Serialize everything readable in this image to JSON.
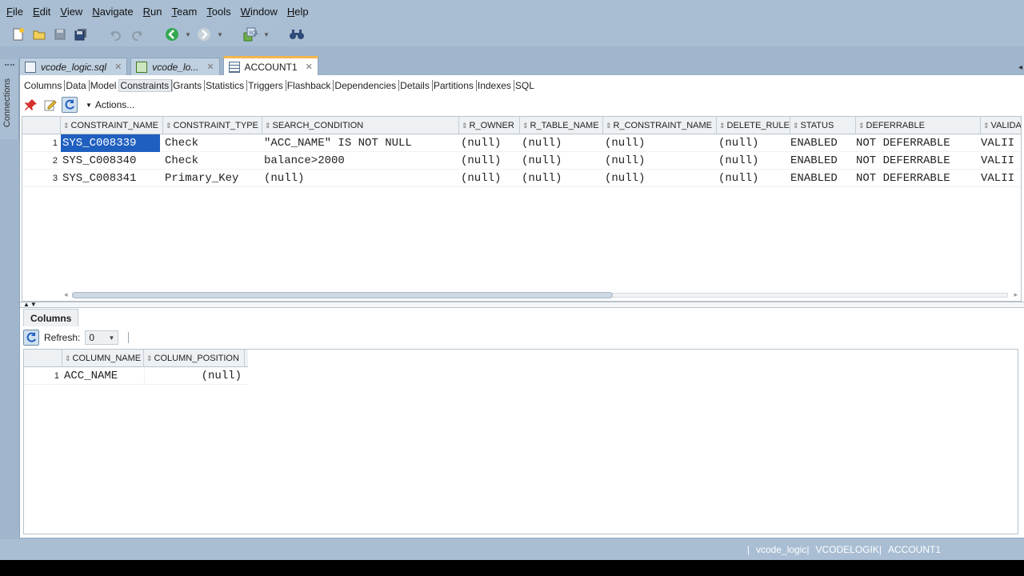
{
  "menu": {
    "items": [
      {
        "label": "File",
        "mnemonic": "F",
        "rest": "ile"
      },
      {
        "label": "Edit",
        "mnemonic": "E",
        "rest": "dit"
      },
      {
        "label": "View",
        "mnemonic": "V",
        "rest": "iew"
      },
      {
        "label": "Navigate",
        "mnemonic": "N",
        "rest": "avigate"
      },
      {
        "label": "Run",
        "mnemonic": "R",
        "rest": "un"
      },
      {
        "label": "Team",
        "mnemonic": "T",
        "rest": "eam"
      },
      {
        "label": "Tools",
        "mnemonic": "T",
        "rest": "ools"
      },
      {
        "label": "Window",
        "mnemonic": "W",
        "rest": "indow"
      },
      {
        "label": "Help",
        "mnemonic": "H",
        "rest": "elp"
      }
    ]
  },
  "toolbar": {
    "icons": [
      "new-file-icon",
      "open-folder-icon",
      "save-icon",
      "save-all-icon",
      "undo-icon",
      "redo-icon",
      "back-icon",
      "forward-icon",
      "sql-worksheet-icon",
      "binoculars-icon"
    ]
  },
  "rail": {
    "label": "Connections"
  },
  "editor_tabs": [
    {
      "label": "vcode_logic.sql",
      "active": false
    },
    {
      "label": "vcode_lo...",
      "active": false
    },
    {
      "label": "ACCOUNT1",
      "active": true
    }
  ],
  "subtabs": [
    "Columns",
    "Data",
    "Model",
    "Constraints",
    "Grants",
    "Statistics",
    "Triggers",
    "Flashback",
    "Dependencies",
    "Details",
    "Partitions",
    "Indexes",
    "SQL"
  ],
  "selected_subtab": "Constraints",
  "actions": {
    "label": "Actions..."
  },
  "constraints": {
    "columns": [
      "CONSTRAINT_NAME",
      "CONSTRAINT_TYPE",
      "SEARCH_CONDITION",
      "R_OWNER",
      "R_TABLE_NAME",
      "R_CONSTRAINT_NAME",
      "DELETE_RULE",
      "STATUS",
      "DEFERRABLE",
      "VALIDA"
    ],
    "rows": [
      {
        "num": "1",
        "cells": [
          "SYS_C008339",
          "Check",
          "\"ACC_NAME\" IS NOT NULL",
          "(null)",
          "(null)",
          "(null)",
          "(null)",
          "ENABLED",
          "NOT DEFERRABLE",
          "VALII"
        ]
      },
      {
        "num": "2",
        "cells": [
          "SYS_C008340",
          "Check",
          "balance>2000",
          "(null)",
          "(null)",
          "(null)",
          "(null)",
          "ENABLED",
          "NOT DEFERRABLE",
          "VALII"
        ]
      },
      {
        "num": "3",
        "cells": [
          "SYS_C008341",
          "Primary_Key",
          "(null)",
          "(null)",
          "(null)",
          "(null)",
          "(null)",
          "ENABLED",
          "NOT DEFERRABLE",
          "VALII"
        ]
      }
    ],
    "selected_cell": {
      "row": 0,
      "col": 0
    }
  },
  "bottom": {
    "tab_label": "Columns",
    "refresh_label": "Refresh:",
    "refresh_value": "0",
    "columns": [
      "COLUMN_NAME",
      "COLUMN_POSITION"
    ],
    "rows": [
      {
        "num": "1",
        "cells": [
          "ACC_NAME",
          "(null)"
        ]
      }
    ]
  },
  "status": {
    "items": [
      "vcode_logic",
      "VCODELOGIK",
      "ACCOUNT1"
    ]
  },
  "colors": {
    "chrome": "#a9bed3",
    "selection": "#1f5fbf",
    "active_tab_accent": "#f5b64b"
  }
}
